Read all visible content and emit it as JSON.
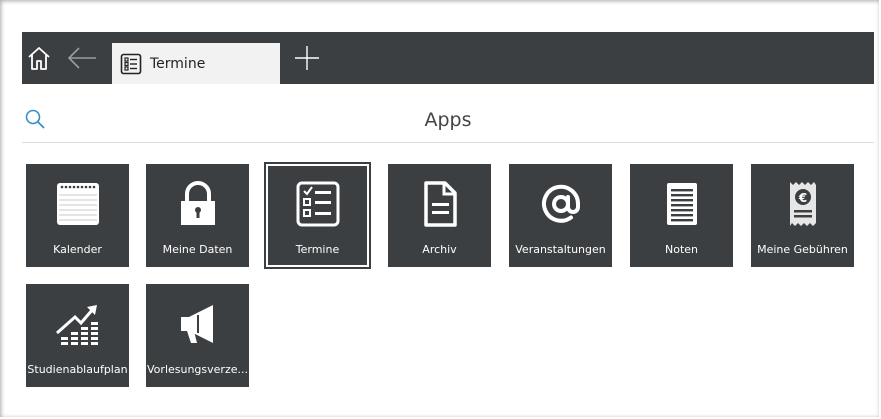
{
  "tabbar": {
    "active_tab_label": "Termine"
  },
  "header": {
    "title": "Apps"
  },
  "apps": [
    {
      "label": "Kalender",
      "icon": "calendar-icon"
    },
    {
      "label": "Meine Daten",
      "icon": "lock-icon"
    },
    {
      "label": "Termine",
      "icon": "checklist-icon",
      "selected": true
    },
    {
      "label": "Archiv",
      "icon": "document-icon"
    },
    {
      "label": "Veranstaltungen",
      "icon": "at-icon"
    },
    {
      "label": "Noten",
      "icon": "notes-icon"
    },
    {
      "label": "Meine Gebühren",
      "icon": "receipt-euro-icon"
    },
    {
      "label": "Studienablaufplan",
      "icon": "growth-chart-icon"
    },
    {
      "label": "Vorlesungsverze...",
      "icon": "megaphone-icon"
    }
  ],
  "colors": {
    "tile_bg": "#3c3f41",
    "tile_text": "#ffffff",
    "search_icon": "#3a8ec8"
  }
}
